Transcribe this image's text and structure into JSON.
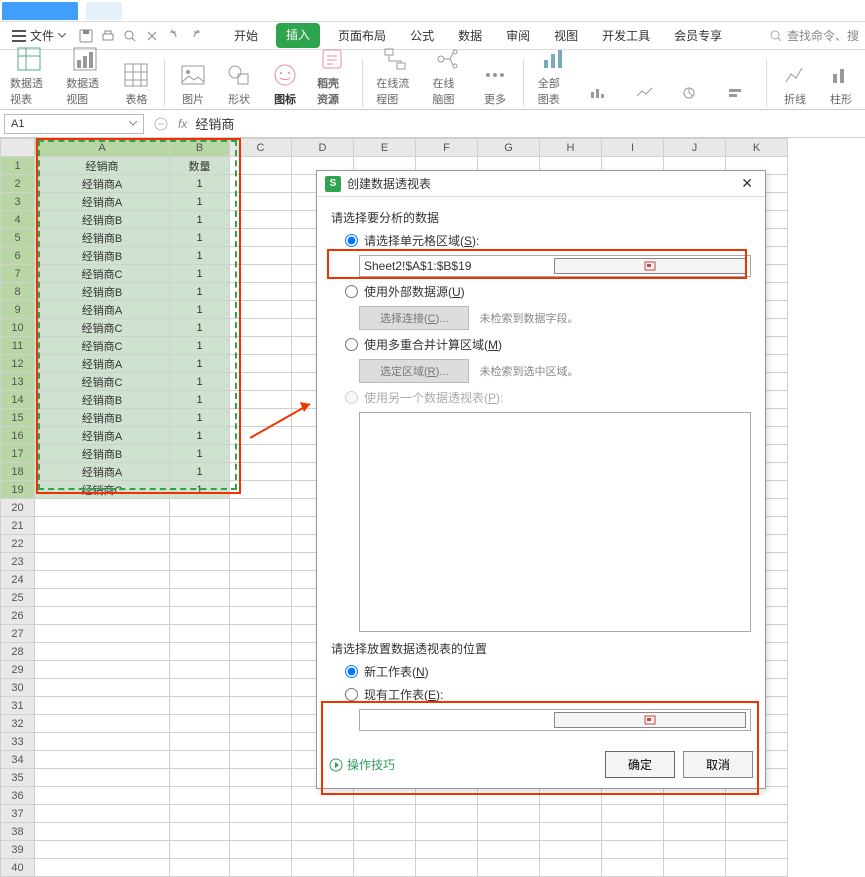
{
  "titlebar": {},
  "menubar": {
    "file_label": "文件",
    "tabs": [
      "开始",
      "插入",
      "页面布局",
      "公式",
      "数据",
      "审阅",
      "视图",
      "开发工具",
      "会员专享"
    ],
    "active_tab": "插入",
    "search_placeholder": "查找命令、搜"
  },
  "ribbon": {
    "pivot_table": "数据透视表",
    "pivot_chart": "数据透视图",
    "table": "表格",
    "pictures": "图片",
    "shapes": "形状",
    "icons": "图标",
    "resources": "稻壳资源",
    "flowchart": "在线流程图",
    "mindmap": "在线脑图",
    "more": "更多",
    "all_charts": "全部图表",
    "fold": "折线",
    "bar": "柱形"
  },
  "namebox": "A1",
  "formula_value": "经销商",
  "columns": [
    "A",
    "B",
    "C",
    "D",
    "E",
    "F",
    "G",
    "H",
    "I",
    "J",
    "K"
  ],
  "data": {
    "header": [
      "经销商",
      "数量"
    ],
    "rows": [
      [
        "经销商A",
        "1"
      ],
      [
        "经销商A",
        "1"
      ],
      [
        "经销商B",
        "1"
      ],
      [
        "经销商B",
        "1"
      ],
      [
        "经销商B",
        "1"
      ],
      [
        "经销商C",
        "1"
      ],
      [
        "经销商B",
        "1"
      ],
      [
        "经销商A",
        "1"
      ],
      [
        "经销商C",
        "1"
      ],
      [
        "经销商C",
        "1"
      ],
      [
        "经销商A",
        "1"
      ],
      [
        "经销商C",
        "1"
      ],
      [
        "经销商B",
        "1"
      ],
      [
        "经销商B",
        "1"
      ],
      [
        "经销商A",
        "1"
      ],
      [
        "经销商B",
        "1"
      ],
      [
        "经销商A",
        "1"
      ],
      [
        "经销商C",
        "1"
      ]
    ]
  },
  "row_count_total": 40,
  "dialog": {
    "title": "创建数据透视表",
    "section1": "请选择要分析的数据",
    "opt_range": "请选择单元格区域(S):",
    "range_value": "Sheet2!$A$1:$B$19",
    "opt_external": "使用外部数据源(U)",
    "btn_choose_conn": "选择连接(C)...",
    "hint_no_fields": "未检索到数据字段。",
    "opt_multi": "使用多重合并计算区域(M)",
    "btn_choose_area": "选定区域(R)...",
    "hint_no_area": "未检索到选中区域。",
    "opt_another": "使用另一个数据透视表(P):",
    "section2": "请选择放置数据透视表的位置",
    "opt_new_sheet": "新工作表(N)",
    "opt_existing": "现有工作表(E):",
    "tips": "操作技巧",
    "ok": "确定",
    "cancel": "取消"
  }
}
